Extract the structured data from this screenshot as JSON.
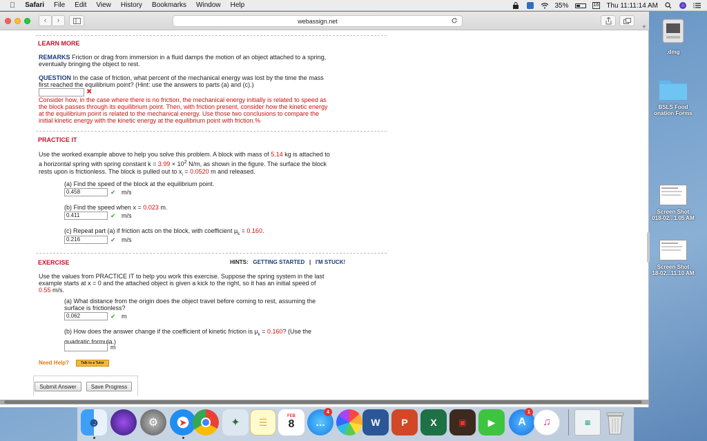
{
  "menubar": {
    "app": "Safari",
    "items": [
      "File",
      "Edit",
      "View",
      "History",
      "Bookmarks",
      "Window",
      "Help"
    ],
    "battery": "35%",
    "clock": "Thu 11:11:14 AM",
    "date_box": "16"
  },
  "browser": {
    "url": "webassign.net"
  },
  "learn_more": {
    "heading": "LEARN MORE",
    "remarks_label": "REMARKS",
    "remarks_text_1": "Friction or drag from immersion in a fluid damps the motion of an object attached to a spring,",
    "remarks_text_2": "eventually bringing the object to rest.",
    "question_label": "QUESTION",
    "question_text_1": "In the case of friction, what percent of the mechanical energy was lost by the time the mass",
    "question_text_2": "first reached the equilibrium point? (Hint: use the answers to parts (a) and (c).)",
    "answer_value": "",
    "feedback_1": "Consider how, in the case where there is no friction, the mechanical energy initially is related to speed as",
    "feedback_2": "the block passes through its equilibrium point. Then, with friction present, consider how the kinetic energy",
    "feedback_3": "at the equilibrium point is related to the mechanical energy. Use those two conclusions to compare the",
    "feedback_4": "initial kinetic energy with the kinetic energy at the equilibrium point with friction.%"
  },
  "practice": {
    "heading": "PRACTICE IT",
    "intro_1a": "Use the worked example above to help you solve this problem. A block with mass of",
    "mass": "5.14",
    "intro_1b": "kg is attached to",
    "intro_2a": "a horizontal spring with spring constant k =",
    "k_value": "3.99",
    "intro_2b": "× 10",
    "intro_2exp": "2",
    "intro_2c": "N/m, as shown in the figure. The surface the block",
    "intro_3a": "rests upon is frictionless. The block is pulled out to x",
    "intro_3b": "i",
    "intro_3c": " =",
    "x_initial": "0.0520",
    "intro_3d": "m and released.",
    "part_a_text": "(a) Find the speed of the block at the equilibrium point.",
    "part_a_value": "0.458",
    "part_a_unit": "m/s",
    "part_b_text_a": "(b) Find the speed when x =",
    "part_b_x": "0.023",
    "part_b_text_b": "m.",
    "part_b_value": "0.411",
    "part_b_unit": "m/s",
    "part_c_text_a": "(c) Repeat part (a) if friction acts on the block, with coefficient μ",
    "part_c_sub": "k",
    "part_c_text_b": " =",
    "part_c_mu": "0.160",
    "part_c_text_c": ".",
    "part_c_value": "0.216",
    "part_c_unit": "m/s"
  },
  "exercise": {
    "heading": "EXERCISE",
    "hints_label": "HINTS:",
    "hint_getting_started": "GETTING STARTED",
    "hint_sep": "|",
    "hint_stuck": "I'M STUCK!",
    "intro_1": "Use the values from PRACTICE IT to help you work this exercise. Suppose the spring system in the last",
    "intro_2": "example starts at x = 0 and the attached object is given a kick to the right, so it has an initial speed of",
    "speed": "0.55",
    "speed_unit": "m/s.",
    "part_a_text_1": "(a) What distance from the origin does the object travel before coming to rest, assuming the",
    "part_a_text_2": "surface is frictionless?",
    "part_a_value": "0.062",
    "part_a_unit": "m",
    "part_b_text_a": "(b) How does the answer change if the coefficient of kinetic friction is μ",
    "part_b_sub": "k",
    "part_b_text_b": " =",
    "part_b_mu": "0.160",
    "part_b_text_c": "? (Use the",
    "part_b_text_2": "quadratic formula.)",
    "part_b_value": "",
    "part_b_unit": "m",
    "need_help": "Need Help?",
    "tutor_button": "Talk to a Tutor"
  },
  "actions": {
    "submit": "Submit Answer",
    "save": "Save Progress"
  },
  "desktop": {
    "icons": [
      {
        "label": ".dmg"
      },
      {
        "label_1": "BSLS Food",
        "label_2": "onation Forms"
      },
      {
        "label_1": "Screen Shot",
        "label_2": "018-02...1.05 AM"
      },
      {
        "label_1": "Screen Shot",
        "label_2": "18-02...11.10 AM"
      }
    ]
  },
  "dock": {
    "messages_badge": "4",
    "appstore_badge": "1",
    "calendar_month": "FEB",
    "calendar_day": "8",
    "word": "W",
    "powerpoint": "P",
    "excel": "X"
  }
}
